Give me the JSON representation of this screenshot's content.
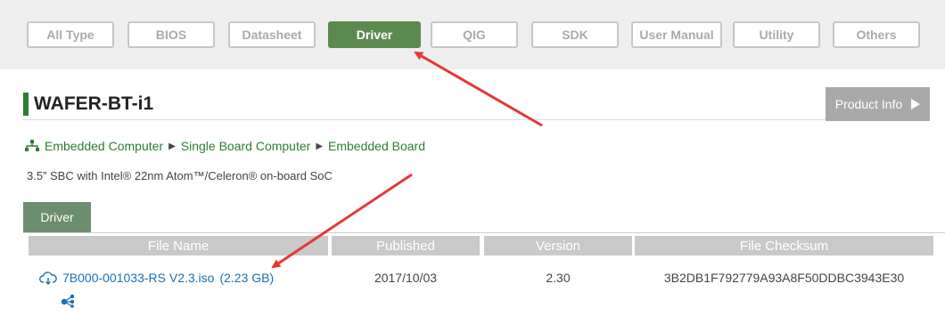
{
  "filters": [
    {
      "label": "All Type",
      "active": false
    },
    {
      "label": "BIOS",
      "active": false
    },
    {
      "label": "Datasheet",
      "active": false
    },
    {
      "label": "Driver",
      "active": true
    },
    {
      "label": "QIG",
      "active": false
    },
    {
      "label": "SDK",
      "active": false
    },
    {
      "label": "User Manual",
      "active": false
    },
    {
      "label": "Utility",
      "active": false
    },
    {
      "label": "Others",
      "active": false
    }
  ],
  "product": {
    "title": "WAFER-BT-i1",
    "info_button": "Product Info",
    "breadcrumb": [
      "Embedded Computer",
      "Single Board Computer",
      "Embedded Board"
    ],
    "description": "3.5” SBC with Intel® 22nm Atom™/Celeron® on-board SoC"
  },
  "tab": {
    "label": "Driver"
  },
  "table": {
    "headers": {
      "file_name": "File Name",
      "published": "Published",
      "version": "Version",
      "checksum": "File Checksum"
    },
    "rows": [
      {
        "file_name": "7B000-001033-RS V2.3.iso",
        "size": "(2.23 GB)",
        "published": "2017/10/03",
        "version": "2.30",
        "checksum": "3B2DB1F792779A93A8F50DDBC3943E30"
      }
    ]
  },
  "colors": {
    "accent_green": "#5b8a4e",
    "link_blue": "#1a6fb5",
    "annotation_red": "#e53935"
  }
}
